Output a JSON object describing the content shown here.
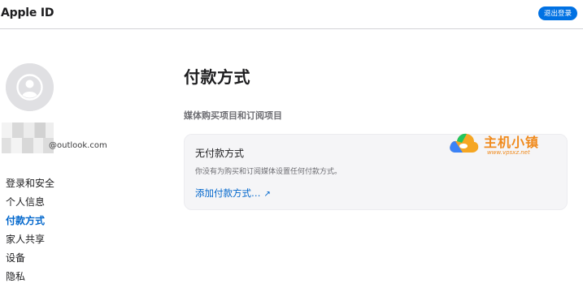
{
  "header": {
    "brand": "Apple ID",
    "sign_out_label": "退出登录"
  },
  "account": {
    "email_visible": "@outlook.com"
  },
  "sidebar": {
    "items": [
      {
        "label": "登录和安全",
        "active": false
      },
      {
        "label": "个人信息",
        "active": false
      },
      {
        "label": "付款方式",
        "active": true
      },
      {
        "label": "家人共享",
        "active": false
      },
      {
        "label": "设备",
        "active": false
      },
      {
        "label": "隐私",
        "active": false
      }
    ]
  },
  "main": {
    "title": "付款方式",
    "section_label": "媒体购买项目和订阅项目",
    "card": {
      "title": "无付款方式",
      "description": "你没有为购买和订阅媒体设置任何付款方式。",
      "link_label": "添加付款方式…",
      "link_icon": "arrow-up-right-icon"
    }
  },
  "watermark": {
    "name": "主机小镇",
    "url": "www.vpsxz.net"
  },
  "colors": {
    "accent": "#0071e3",
    "link": "#0066cc",
    "watermark": "#f08a1c",
    "card_bg": "#f5f5f7"
  }
}
